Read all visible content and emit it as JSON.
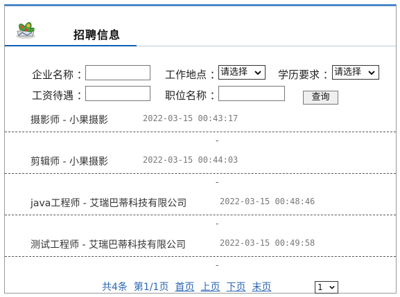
{
  "header": {
    "title": "招聘信息"
  },
  "search": {
    "company_label": "企业名称 ：",
    "company_value": "",
    "location_label": "工作地点 ：",
    "location_value": "请选择",
    "education_label": "学历要求 ：",
    "education_value": "请选择",
    "salary_label": "工资待遇 ：",
    "salary_value": "",
    "position_label": "职位名称 ：",
    "position_value": "",
    "query_label": "查询"
  },
  "jobs": [
    {
      "title": "摄影师 - 小果摄影",
      "date": "2022-03-15 00:43:17"
    },
    {
      "title": "剪辑师 - 小果摄影",
      "date": "2022-03-15 00:44:03"
    },
    {
      "title": "java工程师 - 艾瑞巴蒂科技有限公司",
      "date": "2022-03-15 00:48:46"
    },
    {
      "title": "测试工程师 - 艾瑞巴蒂科技有限公司",
      "date": "2022-03-15 00:49:58"
    }
  ],
  "list_separator": "-",
  "pagination": {
    "total": "共4条",
    "page_info": "第1/1页",
    "first": "首页",
    "prev": "上页",
    "next": "下页",
    "last": "末页",
    "current_page": "1"
  },
  "colors": {
    "top_border": "#4a86c8",
    "header_accent": "#0d5fb4",
    "pager_link": "#2b65b5",
    "date_text": "#777777"
  },
  "icons": {
    "logo": "plant-pot-icon",
    "dropdown": "chevron-down-icon"
  }
}
